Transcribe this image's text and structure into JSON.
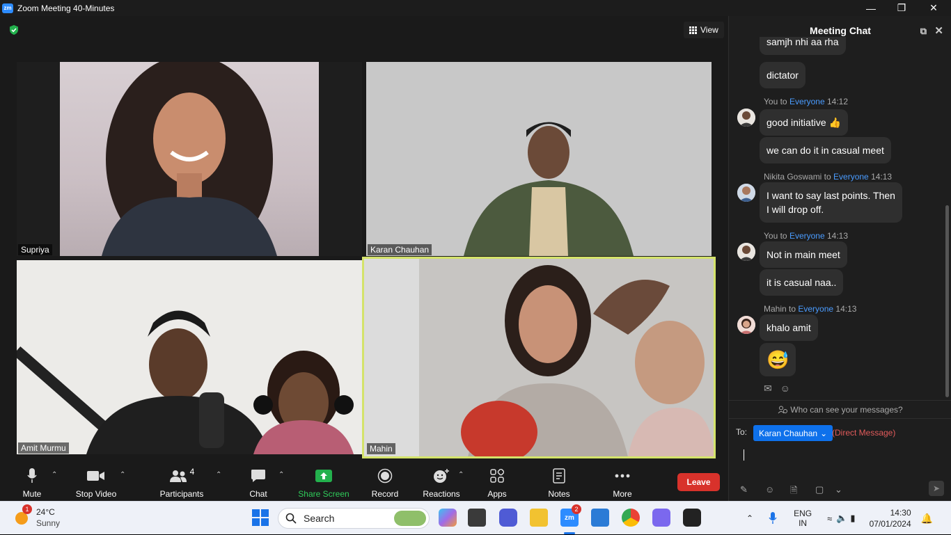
{
  "window": {
    "title": "Zoom Meeting 40-Minutes"
  },
  "stage": {
    "view_label": "View"
  },
  "participants": [
    {
      "name": "Supriya"
    },
    {
      "name": "Karan Chauhan"
    },
    {
      "name": "Amit Murmu"
    },
    {
      "name": "Mahin"
    }
  ],
  "toolbar": {
    "mute": "Mute",
    "stop_video": "Stop Video",
    "participants": "Participants",
    "participant_count": "4",
    "chat": "Chat",
    "share": "Share Screen",
    "record": "Record",
    "reactions": "Reactions",
    "apps": "Apps",
    "notes": "Notes",
    "more": "More",
    "leave": "Leave"
  },
  "chat": {
    "title": "Meeting Chat",
    "messages": {
      "m1": "samjh nhi aa rha",
      "m2": "dictator",
      "h1_sender": "You to ",
      "h1_to": "Everyone",
      "h1_time": "14:12",
      "m3": "good initiative 👍",
      "m4": "we can do it in casual meet",
      "h2_sender": "Nikita Goswami to ",
      "h2_to": "Everyone",
      "h2_time": "14:13",
      "m5_line1": "I want to say last points. Then",
      "m5_line2": "I will drop off.",
      "h3_sender": "You to ",
      "h3_to": "Everyone",
      "h3_time": "14:13",
      "m6": "Not in main meet",
      "m7": "it is casual naa..",
      "h4_sender": "Mahin to ",
      "h4_to": "Everyone",
      "h4_time": "14:13",
      "m8": "khalo amit",
      "m9": "😅"
    },
    "who_can_see": "Who can see your messages?",
    "to_label": "To:",
    "recipient": "Karan Chauhan",
    "direct_message": "(Direct Message)"
  },
  "taskbar": {
    "weather_temp": "24°C",
    "weather_desc": "Sunny",
    "weather_badge": "1",
    "search_placeholder": "Search",
    "zoom_badge": "2",
    "lang_line1": "ENG",
    "lang_line2": "IN",
    "time": "14:30",
    "date": "07/01/2024"
  }
}
